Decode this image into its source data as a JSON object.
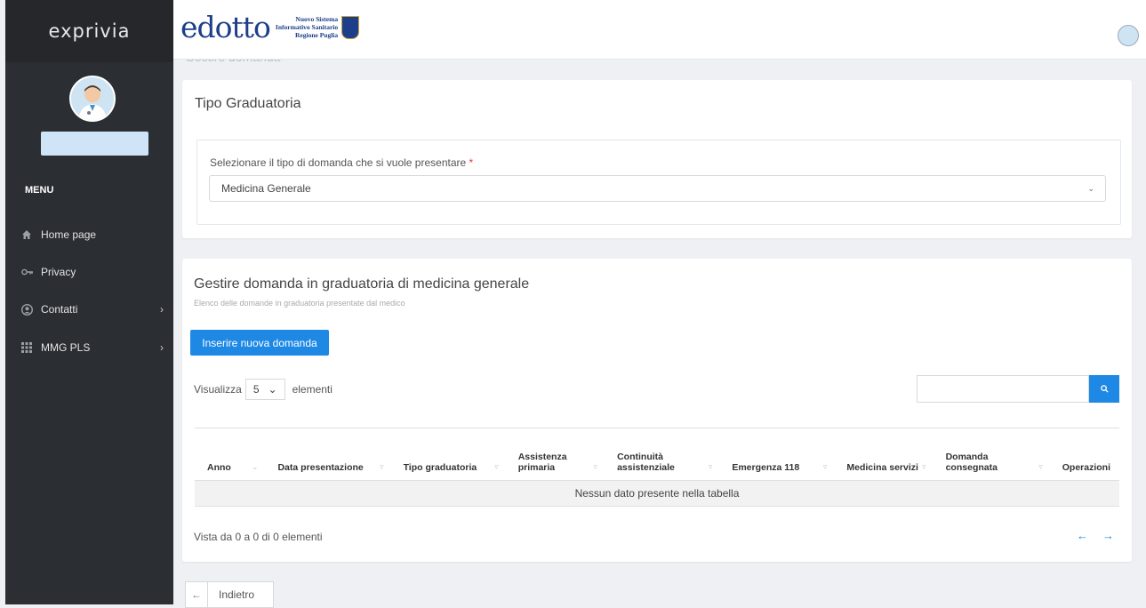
{
  "sidebar": {
    "logo": "exprivia",
    "menu_title": "MENU",
    "items": [
      {
        "label": "Home page",
        "icon": "home-icon"
      },
      {
        "label": "Privacy",
        "icon": "key-icon"
      },
      {
        "label": "Contatti",
        "icon": "user-circle-icon"
      },
      {
        "label": "MMG PLS",
        "icon": "grid-icon"
      }
    ]
  },
  "header": {
    "brand": "edotto",
    "brand_sub": [
      "Nuovo Sistema",
      "Informativo Sanitario",
      "Regione Puglia"
    ],
    "page_title_ghost": "Gestire domanda"
  },
  "tipo": {
    "title": "Tipo Graduatoria",
    "select_label": "Selezionare il tipo di domanda che si vuole presentare",
    "required_mark": "*",
    "selected": "Medicina Generale"
  },
  "main": {
    "title": "Gestire domanda in graduatoria di medicina generale",
    "subtitle": "Elenco delle domande in graduatoria presentate dal medico",
    "new_button": "Inserire nuova domanda",
    "show_label": "Visualizza",
    "page_size": "5",
    "show_suffix": "elementi",
    "columns": [
      "Anno",
      "Data presentazione",
      "Tipo graduatoria",
      "Assistenza primaria",
      "Continuità assistenziale",
      "Emergenza 118",
      "Medicina servizi",
      "Domanda consegnata",
      "Operazioni"
    ],
    "empty_message": "Nessun dato presente nella tabella",
    "info": "Vista da 0 a 0 di 0 elementi",
    "back_label": "Indietro"
  },
  "colors": {
    "accent": "#1e88e5",
    "sidebar_bg": "#2b2e33",
    "brand_blue": "#1d3f8a",
    "required": "#e53935"
  }
}
